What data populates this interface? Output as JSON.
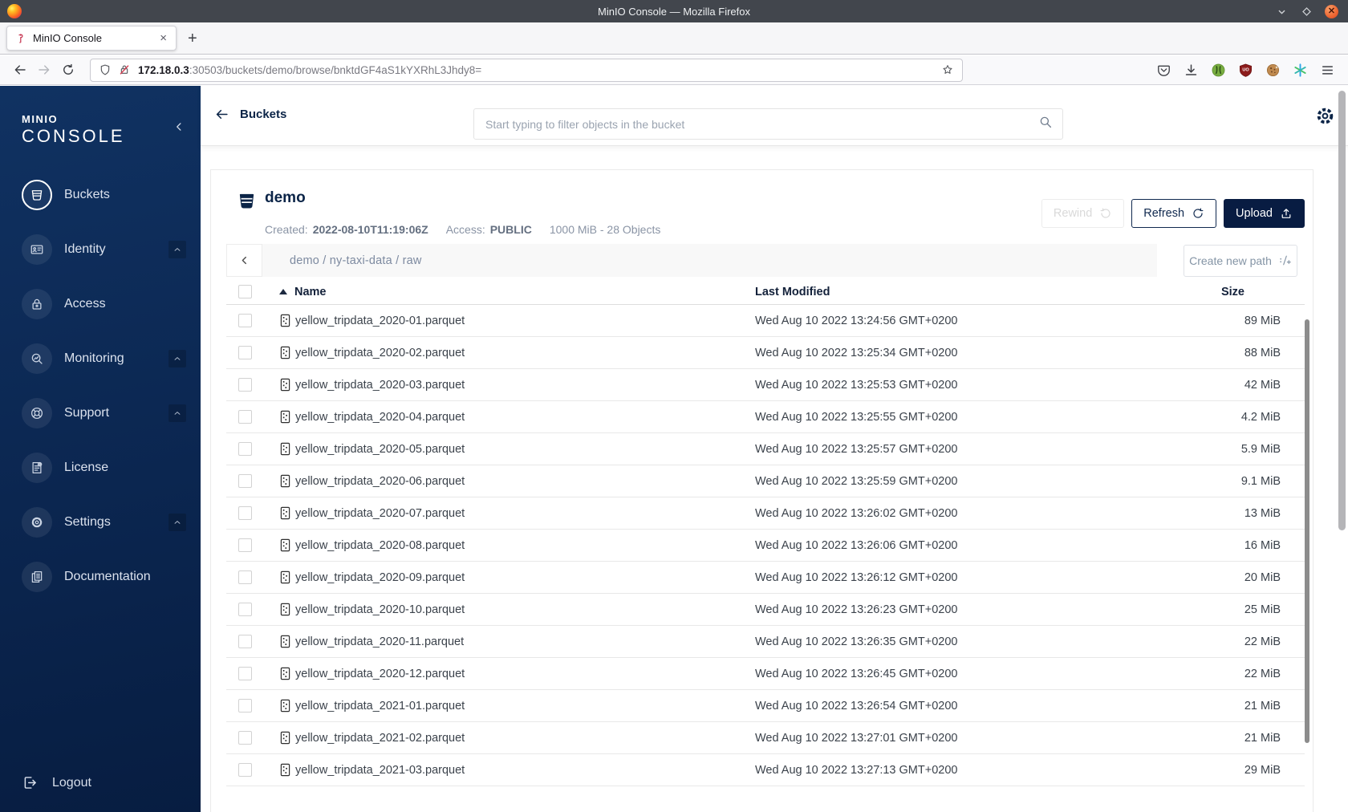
{
  "browser": {
    "window_title": "MinIO Console — Mozilla Firefox",
    "tab": {
      "title": "MinIO Console",
      "close_glyph": "×",
      "favicon": "minio-flamingo-icon"
    },
    "new_tab_label": "+",
    "url": {
      "host": "172.18.0.3",
      "path": ":30503/buckets/demo/browse/bnktdGF4aS1kYXRhL3Jhdy8="
    }
  },
  "sidebar": {
    "logo": {
      "line1": "MINIO",
      "line2": "CONSOLE"
    },
    "items": [
      {
        "label": "Buckets",
        "icon": "bucket-icon",
        "active": true,
        "expandable": false
      },
      {
        "label": "Identity",
        "icon": "identity-icon",
        "active": false,
        "expandable": true
      },
      {
        "label": "Access",
        "icon": "access-lock-icon",
        "active": false,
        "expandable": false
      },
      {
        "label": "Monitoring",
        "icon": "monitoring-icon",
        "active": false,
        "expandable": true
      },
      {
        "label": "Support",
        "icon": "support-icon",
        "active": false,
        "expandable": true
      },
      {
        "label": "License",
        "icon": "license-icon",
        "active": false,
        "expandable": false
      },
      {
        "label": "Settings",
        "icon": "settings-gear-icon",
        "active": false,
        "expandable": true
      },
      {
        "label": "Documentation",
        "icon": "documentation-icon",
        "active": false,
        "expandable": false
      }
    ],
    "logout": {
      "label": "Logout",
      "icon": "logout-icon"
    }
  },
  "header": {
    "back_label": "Buckets",
    "search_placeholder": "Start typing to filter objects in the bucket"
  },
  "bucket": {
    "name": "demo",
    "created_label": "Created:",
    "created_value": "2022-08-10T11:19:06Z",
    "access_label": "Access:",
    "access_value": "PUBLIC",
    "usage": "1000 MiB - 28 Objects",
    "actions": [
      {
        "label": "Rewind",
        "icon": "rewind-icon",
        "style": "disabled"
      },
      {
        "label": "Refresh",
        "icon": "refresh-icon",
        "style": "outline"
      },
      {
        "label": "Upload",
        "icon": "upload-icon",
        "style": "primary"
      }
    ]
  },
  "browse": {
    "path_segments": [
      "demo",
      "ny-taxi-data",
      "raw"
    ],
    "create_path_label": "Create new path",
    "create_path_icon": "new-path-icon"
  },
  "table": {
    "columns": [
      "Name",
      "Last Modified",
      "Size"
    ],
    "row_icon": "parquet-file-icon",
    "rows": [
      {
        "name": "yellow_tripdata_2020-01.parquet",
        "modified": "Wed Aug 10 2022 13:24:56 GMT+0200",
        "size": "89 MiB"
      },
      {
        "name": "yellow_tripdata_2020-02.parquet",
        "modified": "Wed Aug 10 2022 13:25:34 GMT+0200",
        "size": "88 MiB"
      },
      {
        "name": "yellow_tripdata_2020-03.parquet",
        "modified": "Wed Aug 10 2022 13:25:53 GMT+0200",
        "size": "42 MiB"
      },
      {
        "name": "yellow_tripdata_2020-04.parquet",
        "modified": "Wed Aug 10 2022 13:25:55 GMT+0200",
        "size": "4.2 MiB"
      },
      {
        "name": "yellow_tripdata_2020-05.parquet",
        "modified": "Wed Aug 10 2022 13:25:57 GMT+0200",
        "size": "5.9 MiB"
      },
      {
        "name": "yellow_tripdata_2020-06.parquet",
        "modified": "Wed Aug 10 2022 13:25:59 GMT+0200",
        "size": "9.1 MiB"
      },
      {
        "name": "yellow_tripdata_2020-07.parquet",
        "modified": "Wed Aug 10 2022 13:26:02 GMT+0200",
        "size": "13 MiB"
      },
      {
        "name": "yellow_tripdata_2020-08.parquet",
        "modified": "Wed Aug 10 2022 13:26:06 GMT+0200",
        "size": "16 MiB"
      },
      {
        "name": "yellow_tripdata_2020-09.parquet",
        "modified": "Wed Aug 10 2022 13:26:12 GMT+0200",
        "size": "20 MiB"
      },
      {
        "name": "yellow_tripdata_2020-10.parquet",
        "modified": "Wed Aug 10 2022 13:26:23 GMT+0200",
        "size": "25 MiB"
      },
      {
        "name": "yellow_tripdata_2020-11.parquet",
        "modified": "Wed Aug 10 2022 13:26:35 GMT+0200",
        "size": "22 MiB"
      },
      {
        "name": "yellow_tripdata_2020-12.parquet",
        "modified": "Wed Aug 10 2022 13:26:45 GMT+0200",
        "size": "22 MiB"
      },
      {
        "name": "yellow_tripdata_2021-01.parquet",
        "modified": "Wed Aug 10 2022 13:26:54 GMT+0200",
        "size": "21 MiB"
      },
      {
        "name": "yellow_tripdata_2021-02.parquet",
        "modified": "Wed Aug 10 2022 13:27:01 GMT+0200",
        "size": "21 MiB"
      },
      {
        "name": "yellow_tripdata_2021-03.parquet",
        "modified": "Wed Aug 10 2022 13:27:13 GMT+0200",
        "size": "29 MiB"
      }
    ]
  },
  "colors": {
    "navy": "#081C42",
    "sidebar_top": "#103262",
    "sidebar_bottom": "#071d41",
    "titlebar": "#42464d",
    "row_border": "#e8e8e8"
  }
}
